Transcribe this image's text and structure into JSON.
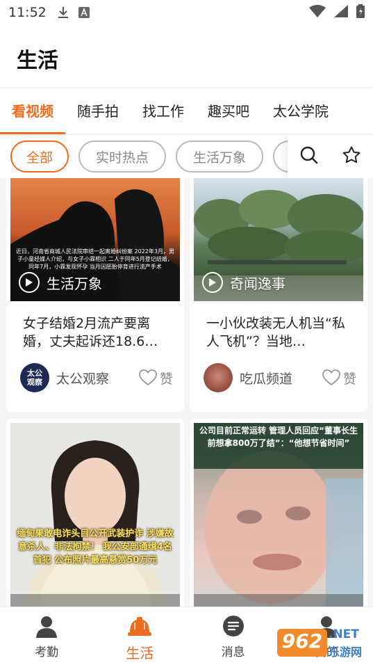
{
  "status": {
    "time": "11:52"
  },
  "header": {
    "title": "生活"
  },
  "tabs": [
    {
      "label": "看视频",
      "active": true
    },
    {
      "label": "随手拍"
    },
    {
      "label": "找工作"
    },
    {
      "label": "趣买吧"
    },
    {
      "label": "太公学院"
    }
  ],
  "chips": [
    {
      "label": "全部",
      "active": true
    },
    {
      "label": "实时热点"
    },
    {
      "label": "生活万象"
    }
  ],
  "cards": [
    {
      "tag": "生活万象",
      "title": "女子结婚2月流产要离婚，丈夫起诉还18.6…",
      "overlay": "近日，河南省商城人民法院审结一起离婚纠纷案 2022年3月，男子小童经媒人介绍，与女子小霖相识 二人于同年5月登记结婚，同年7月，小霖发现怀孕 当月因胚胎停育进行流产手术",
      "author": "太公观察",
      "avatar_text": "太公观察",
      "like": "赞"
    },
    {
      "tag": "奇闻逸事",
      "title": "一小伙改装无人机当“私人飞机”？当地…",
      "author": "吃瓜频道",
      "like": "赞"
    },
    {
      "overlay": "缅甸果敢电诈头目公开武装护诈 涉嫌故意杀人、非法拘禁！ 我公安部通缉4名首犯 公布照片最高悬赏50万元"
    },
    {
      "overlay": "公司目前正常运转 管理人员回应“董事长生前想拿800万了结”：“他想节省时间”"
    }
  ],
  "bottom_nav": [
    {
      "label": "考勤"
    },
    {
      "label": "生活",
      "active": true
    },
    {
      "label": "消息"
    },
    {
      "label": "我的"
    }
  ],
  "watermark": {
    "number": "962",
    "suffix": ".NET",
    "site": "乐游网"
  },
  "colors": {
    "accent": "#ef6c1f"
  }
}
